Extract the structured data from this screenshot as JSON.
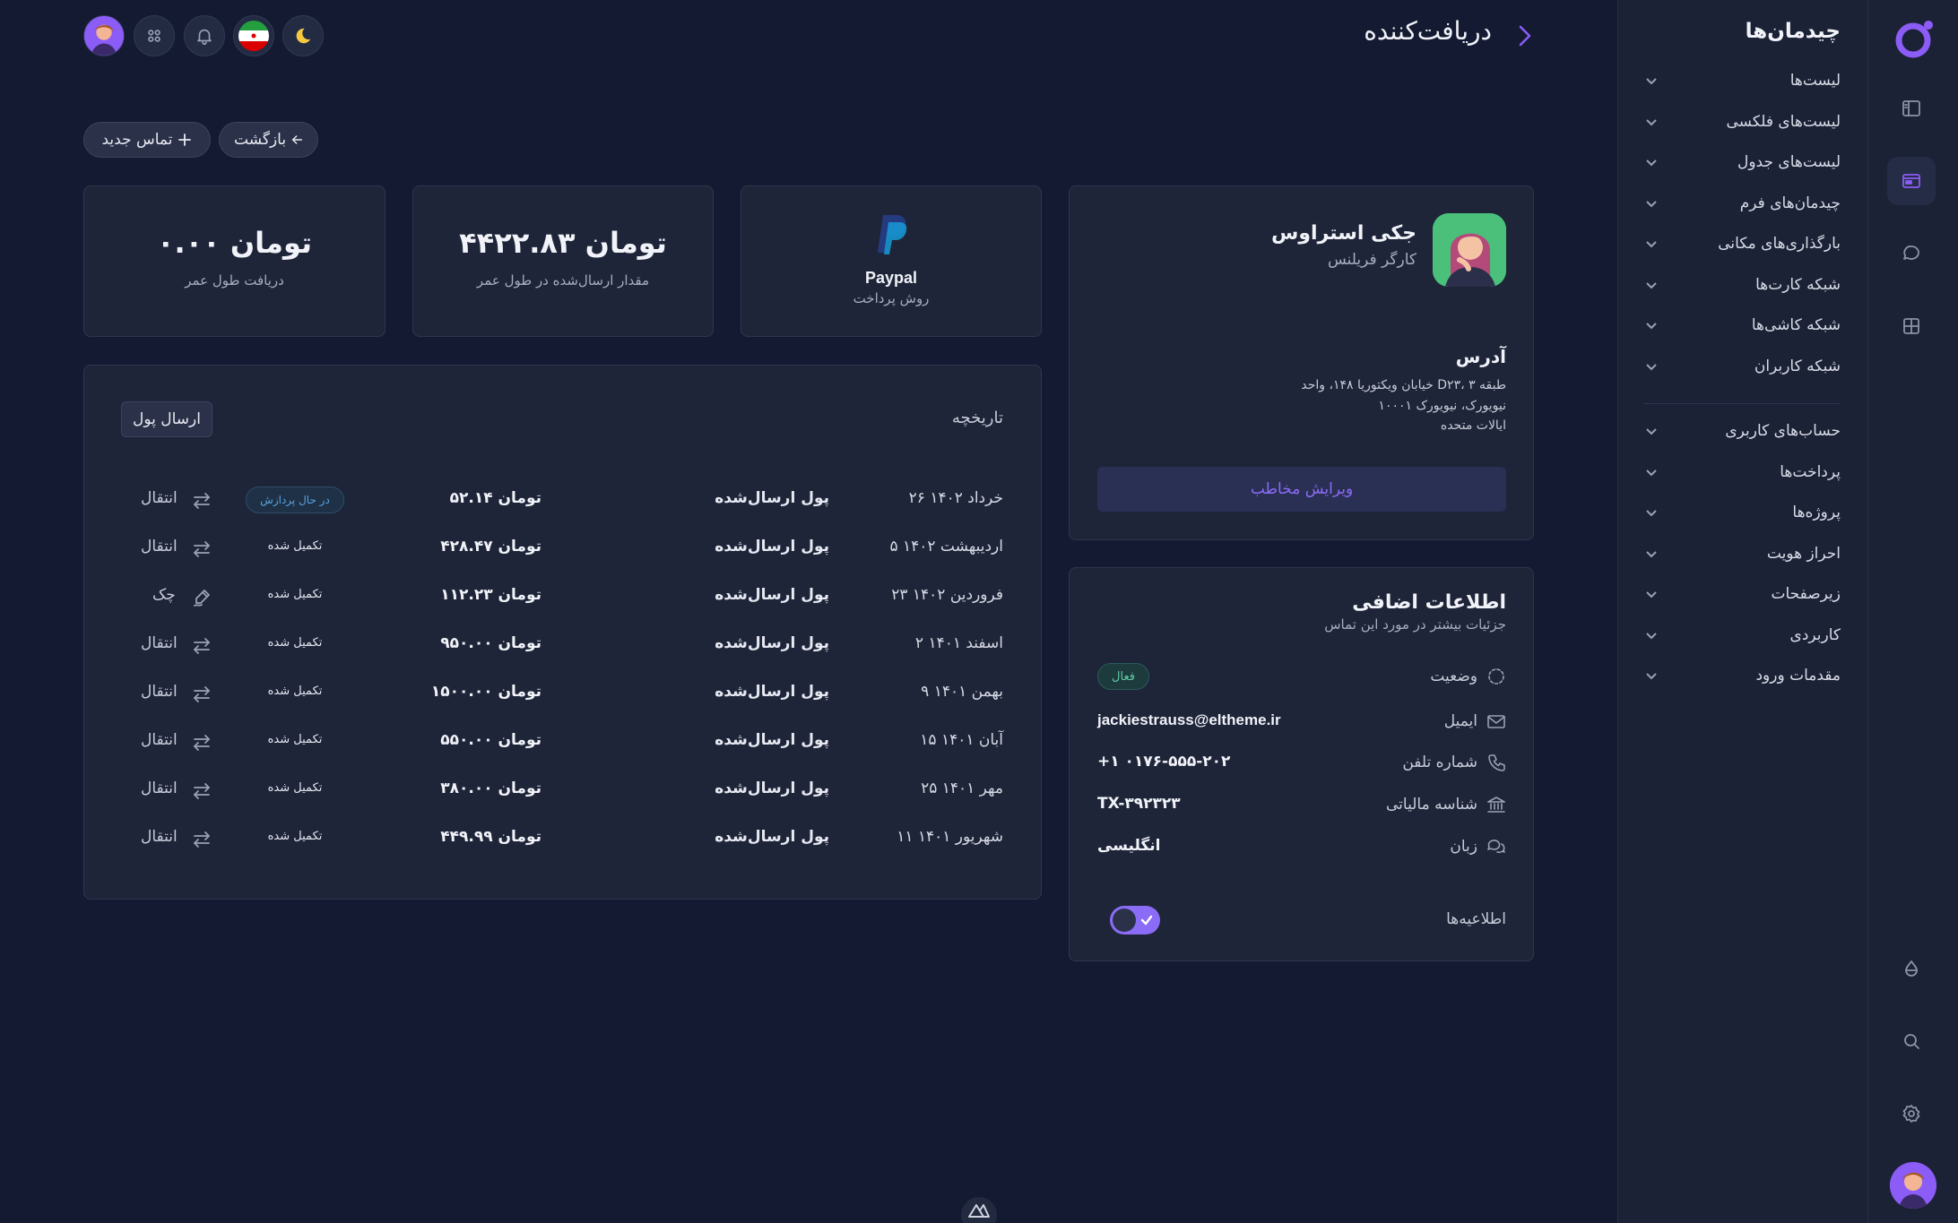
{
  "header": {
    "title": "دریافت‌کننده",
    "back_label": "بازگشت",
    "new_contact_label": "تماس جدید"
  },
  "sidebar": {
    "title": "چیدمان‌ها",
    "items": [
      {
        "label": "لیست‌ها"
      },
      {
        "label": "لیست‌های فلکسی"
      },
      {
        "label": "لیست‌های جدول"
      },
      {
        "label": "چیدمان‌های فرم"
      },
      {
        "label": "بارگذاری‌های مکانی"
      },
      {
        "label": "شبکه کارت‌ها"
      },
      {
        "label": "شبکه کاشی‌ها"
      },
      {
        "label": "شبکه کاربران"
      }
    ],
    "items2": [
      {
        "label": "حساب‌های کاربری"
      },
      {
        "label": "پرداخت‌ها"
      },
      {
        "label": "پروژه‌ها"
      },
      {
        "label": "احراز هویت"
      },
      {
        "label": "زیرصفحات"
      },
      {
        "label": "کاربردی"
      },
      {
        "label": "مقدمات ورود"
      }
    ]
  },
  "stats": {
    "payment_method": {
      "value": "Paypal",
      "label": "روش پرداخت"
    },
    "sent": {
      "value": "۴۴۲۲.۸۳ تومان",
      "label": "مقدار ارسال‌شده در طول عمر"
    },
    "received": {
      "value": "۰.۰۰ تومان",
      "label": "دریافت طول عمر"
    }
  },
  "history": {
    "title": "تاریخچه",
    "send_label": "ارسال پول",
    "rows": [
      {
        "date": "۲۶ خرداد ۱۴۰۲",
        "desc": "پول ارسال‌شده",
        "amount": "۵۲.۱۴ تومان",
        "status": "در حال پردازش",
        "method": "انتقال",
        "method_icon": "transfer-icon"
      },
      {
        "date": "۵ اردیبهشت ۱۴۰۲",
        "desc": "پول ارسال‌شده",
        "amount": "۴۲۸.۴۷ تومان",
        "status": "تکمیل شده",
        "method": "انتقال",
        "method_icon": "transfer-icon"
      },
      {
        "date": "۲۳ فروردین ۱۴۰۲",
        "desc": "پول ارسال‌شده",
        "amount": "۱۱۲.۲۳ تومان",
        "status": "تکمیل شده",
        "method": "چک",
        "method_icon": "signature-icon"
      },
      {
        "date": "۲ اسفند ۱۴۰۱",
        "desc": "پول ارسال‌شده",
        "amount": "۹۵۰.۰۰ تومان",
        "status": "تکمیل شده",
        "method": "انتقال",
        "method_icon": "transfer-icon"
      },
      {
        "date": "۹ بهمن ۱۴۰۱",
        "desc": "پول ارسال‌شده",
        "amount": "۱۵۰۰.۰۰ تومان",
        "status": "تکمیل شده",
        "method": "انتقال",
        "method_icon": "transfer-icon"
      },
      {
        "date": "۱۵ آبان ۱۴۰۱",
        "desc": "پول ارسال‌شده",
        "amount": "۵۵۰.۰۰ تومان",
        "status": "تکمیل شده",
        "method": "انتقال",
        "method_icon": "transfer-icon"
      },
      {
        "date": "۲۵ مهر ۱۴۰۱",
        "desc": "پول ارسال‌شده",
        "amount": "۳۸۰.۰۰ تومان",
        "status": "تکمیل شده",
        "method": "انتقال",
        "method_icon": "transfer-icon"
      },
      {
        "date": "۱۱ شهریور ۱۴۰۱",
        "desc": "پول ارسال‌شده",
        "amount": "۴۴۹.۹۹ تومان",
        "status": "تکمیل شده",
        "method": "انتقال",
        "method_icon": "transfer-icon"
      }
    ]
  },
  "profile": {
    "name": "جکی استراوس",
    "role": "کارگر فریلنس",
    "address_title": "آدرس",
    "address_lines": [
      "خیابان ویکتوریا ۱۴۸، واحد D۲۳، طبقه ۳",
      "نیویورک، نیویورک ۱۰۰۰۱",
      "ایالات متحده"
    ],
    "edit_label": "ویرایش مخاطب"
  },
  "extra": {
    "title": "اطلاعات اضافی",
    "subtitle": "جزئیات بیشتر در مورد این تماس",
    "status_label": "وضعیت",
    "status_value": "فعال",
    "email_label": "ایمیل",
    "email_value": "jackiestrauss@eltheme.ir",
    "phone_label": "شماره تلفن",
    "phone_value": "+۱ ۰۱۷۶-۵۵۵-۲۰۲",
    "tax_label": "شناسه مالیاتی",
    "tax_value": "TX-۳۹۲۳۲۳",
    "lang_label": "زبان",
    "lang_value": "انگلیسی",
    "notif_label": "اطلاعیه‌ها",
    "notif_enabled": true
  },
  "colors": {
    "accent": "#8b5cf6",
    "background": "#141a31",
    "card": "#1e2538"
  }
}
